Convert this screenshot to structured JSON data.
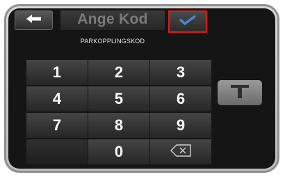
{
  "header": {
    "title": "Ange Kod",
    "subtitle": "PARKOPPLINGSKOD"
  },
  "icons": {
    "back": "left-arrow-icon",
    "confirm": "checkmark-icon",
    "backspace": "backspace-icon",
    "side": "keyboard-toggle-icon"
  },
  "keypad": {
    "keys": [
      "1",
      "2",
      "3",
      "4",
      "5",
      "6",
      "7",
      "8",
      "9",
      "",
      "0"
    ]
  },
  "colors": {
    "confirm_border": "#e01818",
    "checkmark": "#4f86c6"
  }
}
